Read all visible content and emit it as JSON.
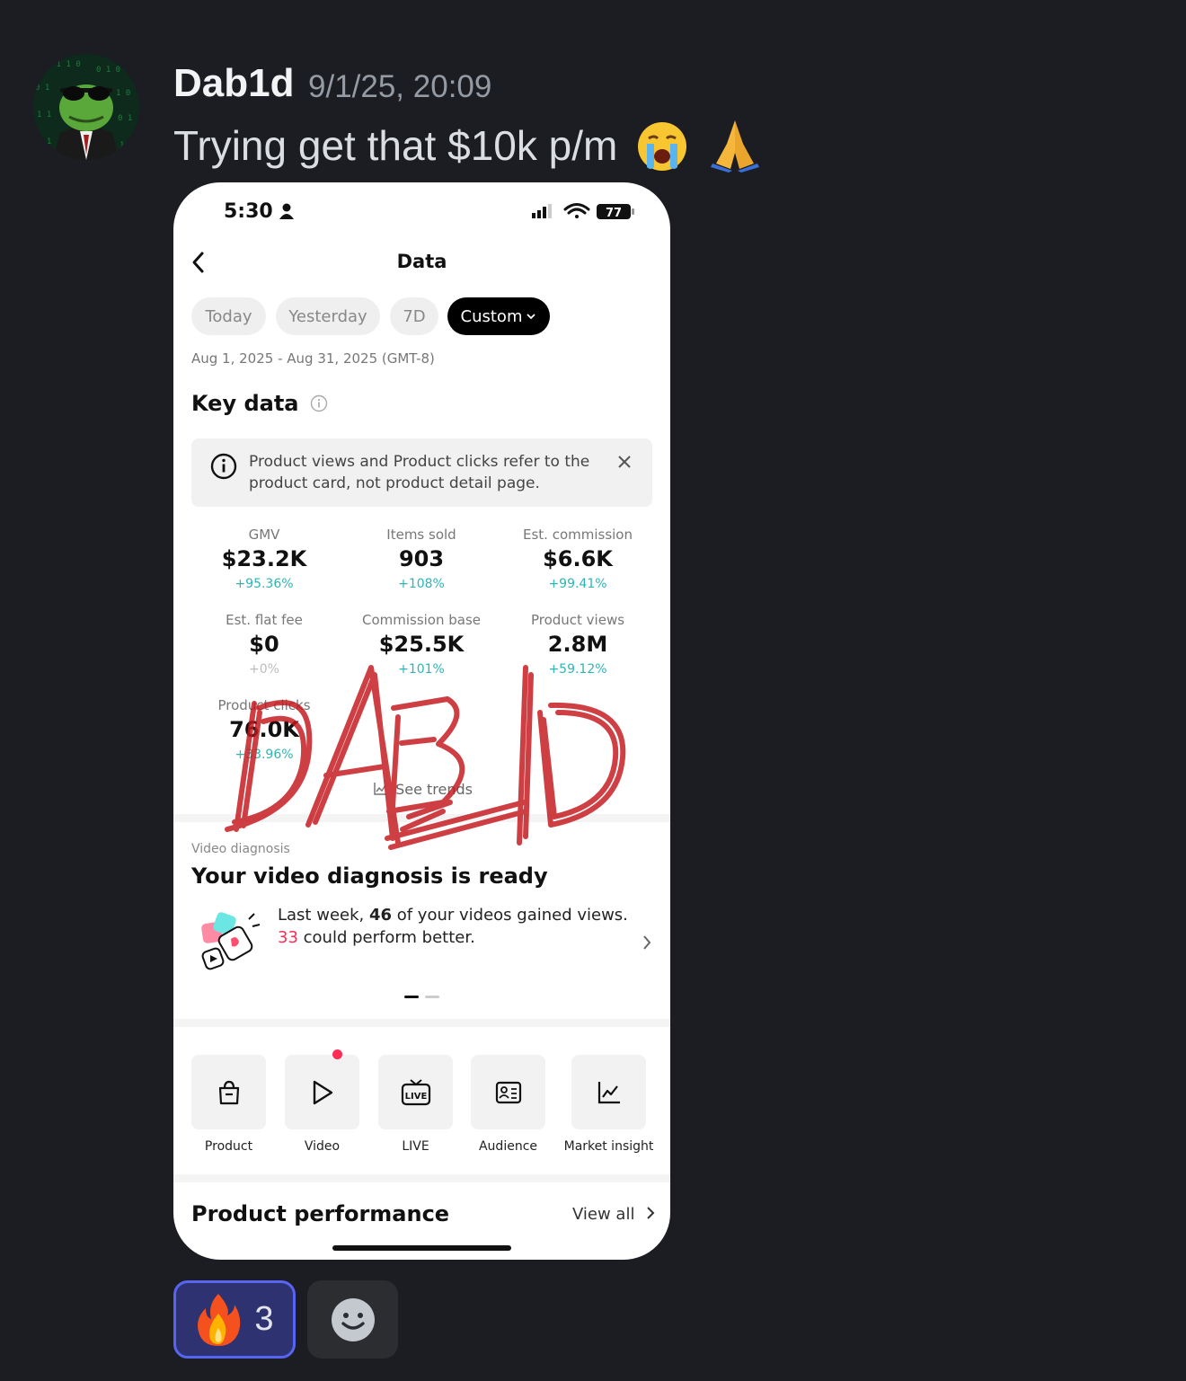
{
  "message": {
    "author": "Dab1d",
    "timestamp": "9/1/25, 20:09",
    "text": "Trying get that $10k p/m",
    "emojis": [
      "loudly-crying-face",
      "folded-hands"
    ]
  },
  "phone": {
    "status": {
      "time": "5:30",
      "battery": "77"
    },
    "header": {
      "title": "Data"
    },
    "ranges": [
      "Today",
      "Yesterday",
      "7D",
      "Custom"
    ],
    "active_range": "Custom",
    "date_range": "Aug 1, 2025 - Aug 31, 2025 (GMT-8)",
    "key_data_title": "Key data",
    "notice": "Product views and Product clicks refer to the product card, not product detail page.",
    "metrics": [
      {
        "label": "GMV",
        "value": "$23.2K",
        "change": "+95.36%"
      },
      {
        "label": "Items sold",
        "value": "903",
        "change": "+108%"
      },
      {
        "label": "Est. commission",
        "value": "$6.6K",
        "change": "+99.41%"
      },
      {
        "label": "Est. flat fee",
        "value": "$0",
        "change": "+0%"
      },
      {
        "label": "Commission base",
        "value": "$25.5K",
        "change": "+101%"
      },
      {
        "label": "Product views",
        "value": "2.8M",
        "change": "+59.12%"
      },
      {
        "label": "Product clicks",
        "value": "76.0K",
        "change": "+33.96%"
      }
    ],
    "see_trends": "See trends",
    "video_diagnosis": {
      "label": "Video diagnosis",
      "title": "Your video diagnosis is ready",
      "line1_pre": "Last week, ",
      "line1_num": "46",
      "line1_post": " of your videos gained views.",
      "line2_num": "33",
      "line2_post": " could perform better."
    },
    "tiles": [
      "Product",
      "Video",
      "LIVE",
      "Audience",
      "Market insight"
    ],
    "product_performance": {
      "title": "Product performance",
      "view_all": "View all"
    },
    "watermark": "DABID"
  },
  "reactions": [
    {
      "emoji": "fire",
      "count": "3"
    }
  ],
  "colors": {
    "background": "#1c1d22",
    "accent": "#5865f2",
    "positive_change": "#2eb5b4",
    "highlight": "#fe2c55",
    "watermark": "#c4161c"
  }
}
